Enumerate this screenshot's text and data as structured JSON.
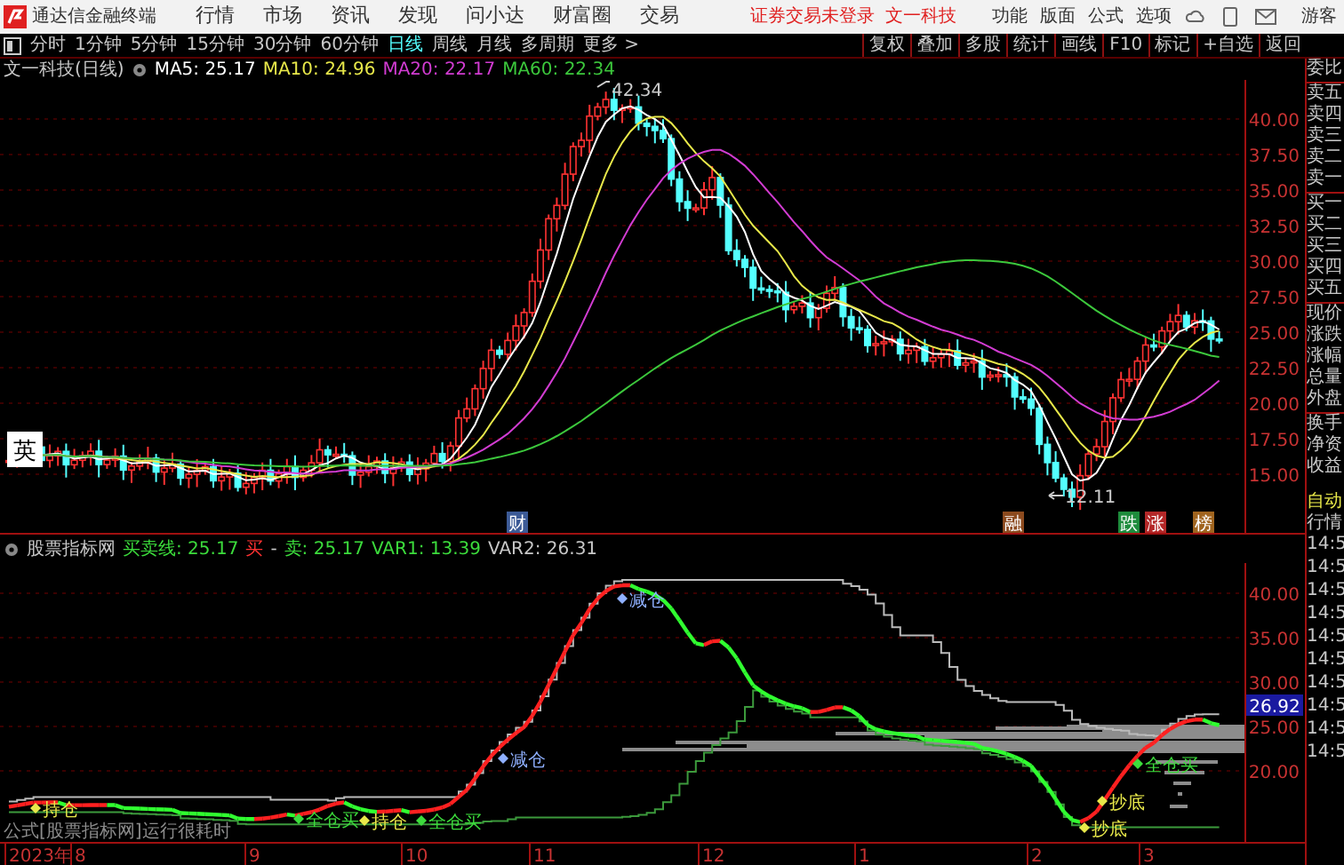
{
  "app": {
    "title": "通达信金融终端",
    "menu": [
      "行情",
      "市场",
      "资讯",
      "发现",
      "问小达",
      "财富圈",
      "交易"
    ],
    "login_notice": "证券交易未登录",
    "stock_link": "文一科技",
    "right_menu": [
      "功能",
      "版面",
      "公式",
      "选项"
    ],
    "user": "游客"
  },
  "period_tabs": [
    {
      "label": "分时",
      "selected": false
    },
    {
      "label": "1分钟",
      "selected": false
    },
    {
      "label": "5分钟",
      "selected": false
    },
    {
      "label": "15分钟",
      "selected": false
    },
    {
      "label": "30分钟",
      "selected": false
    },
    {
      "label": "60分钟",
      "selected": false
    },
    {
      "label": "日线",
      "selected": true
    },
    {
      "label": "周线",
      "selected": false
    },
    {
      "label": "月线",
      "selected": false
    },
    {
      "label": "多周期",
      "selected": false
    },
    {
      "label": "更多 >",
      "selected": false
    }
  ],
  "tool_buttons": [
    "复权",
    "叠加",
    "多股",
    "统计",
    "画线",
    "F10",
    "标记",
    "+自选",
    "返回"
  ],
  "main_chart": {
    "title": "文一科技(日线)",
    "indicators": [
      {
        "label": "MA5: 25.17",
        "color": "#ffffff"
      },
      {
        "label": "MA10: 24.96",
        "color": "#e8e84a"
      },
      {
        "label": "MA20: 22.17",
        "color": "#d23cd2"
      },
      {
        "label": "MA60: 22.34",
        "color": "#3cc83c"
      }
    ],
    "price_axis": [
      "40.00",
      "37.50",
      "35.00",
      "32.50",
      "30.00",
      "27.50",
      "25.00",
      "22.50",
      "20.00",
      "17.50",
      "15.00"
    ],
    "high_label": "42.34",
    "low_label": "12.11",
    "tag": "英",
    "event_tags": [
      {
        "label": "财",
        "color": "#3c5a96"
      },
      {
        "label": "融",
        "color": "#8c4a1e"
      },
      {
        "label": "跌",
        "color": "#1e8c3c"
      },
      {
        "label": "涨",
        "color": "#b42828"
      },
      {
        "label": "榜",
        "color": "#a0641e"
      }
    ]
  },
  "indicator_chart": {
    "title": "股票指标网",
    "readouts": [
      {
        "label": "买卖线: 25.17",
        "color": "#3cdc3c"
      },
      {
        "label": "买",
        "color": "#ff3232"
      },
      {
        "label": "-",
        "color": "#c8c8c8"
      },
      {
        "label": "卖: 25.17",
        "color": "#3cdc3c"
      },
      {
        "label": "VAR1: 13.39",
        "color": "#3cdc3c"
      },
      {
        "label": "VAR2: 26.31",
        "color": "#c8c8c8"
      }
    ],
    "price_axis": [
      "40.00",
      "35.00",
      "30.00",
      "25.00",
      "20.00"
    ],
    "current_price": "26.92",
    "signals": [
      {
        "label": "持仓",
        "kind": "hold"
      },
      {
        "label": "全仓买",
        "kind": "buy"
      },
      {
        "label": "持仓",
        "kind": "hold"
      },
      {
        "label": "全仓买",
        "kind": "buy"
      },
      {
        "label": "减仓",
        "kind": "sell"
      },
      {
        "label": "减仓",
        "kind": "sell"
      },
      {
        "label": "全仓买",
        "kind": "buy"
      },
      {
        "label": "抄底",
        "kind": "hold"
      },
      {
        "label": "抄底",
        "kind": "hold"
      }
    ],
    "notice": "公式[股票指标网]运行很耗时"
  },
  "date_axis": [
    "2023年",
    "8",
    "9",
    "10",
    "11",
    "12",
    "1",
    "2",
    "3"
  ],
  "quote_panel": {
    "labels": [
      "委比",
      "卖五",
      "卖四",
      "卖三",
      "卖二",
      "卖一",
      "买一",
      "买二",
      "买三",
      "买四",
      "买五",
      "现价",
      "涨跌",
      "涨幅",
      "总量",
      "外盘",
      "换手",
      "净资",
      "收益"
    ],
    "auto": "自动",
    "market": "行情",
    "times": [
      "14:5",
      "14:5",
      "14:5",
      "14:5",
      "14:5",
      "14:5",
      "14:5",
      "14:5",
      "14:5",
      "14:5"
    ]
  }
}
